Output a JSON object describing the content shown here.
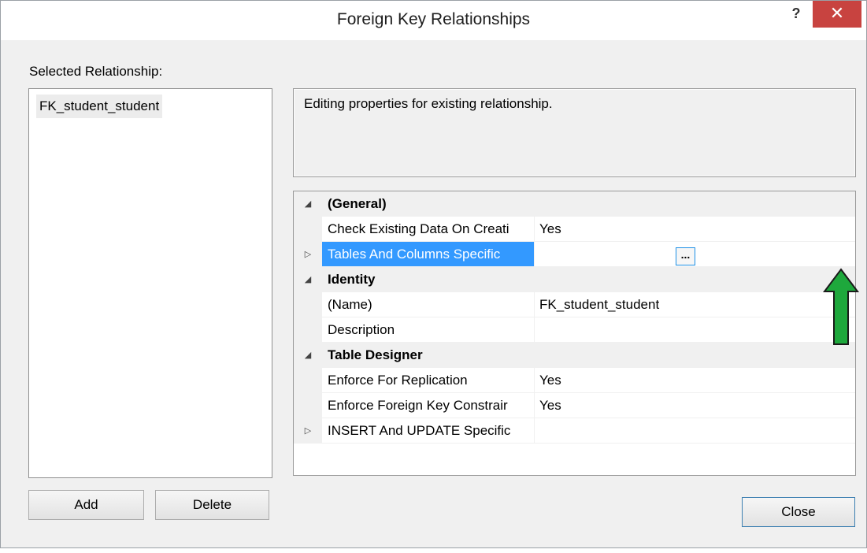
{
  "dialog": {
    "title": "Foreign Key Relationships",
    "help_glyph": "?",
    "close_glyph": "✕"
  },
  "left": {
    "selected_label": "Selected Relationship:",
    "relationships": [
      "FK_student_student"
    ],
    "add_label": "Add",
    "delete_label": "Delete"
  },
  "info_text": "Editing properties for existing relationship.",
  "properties": {
    "general": {
      "label": "(General)",
      "check_existing": {
        "name": "Check Existing Data On Creati",
        "value": "Yes"
      },
      "tables_columns": {
        "name": "Tables And Columns Specific",
        "value": "",
        "button": "..."
      }
    },
    "identity": {
      "label": "Identity",
      "name_prop": {
        "name": "(Name)",
        "value": "FK_student_student"
      },
      "description": {
        "name": "Description",
        "value": ""
      }
    },
    "table_designer": {
      "label": "Table Designer",
      "enforce_replication": {
        "name": "Enforce For Replication",
        "value": "Yes"
      },
      "enforce_fk": {
        "name": "Enforce Foreign Key Constrair",
        "value": "Yes"
      },
      "insert_update": {
        "name": "INSERT And UPDATE Specific",
        "value": ""
      }
    }
  },
  "footer": {
    "close_label": "Close"
  },
  "colors": {
    "selection": "#3399ff",
    "close_button": "#c84340",
    "arrow_fill": "#1ea83c",
    "dialog_bg": "#f0f0f0"
  },
  "icons": {
    "expanded": "expanded-triangle-icon",
    "collapsed": "collapsed-triangle-icon",
    "annotation": "green-up-arrow-icon"
  }
}
